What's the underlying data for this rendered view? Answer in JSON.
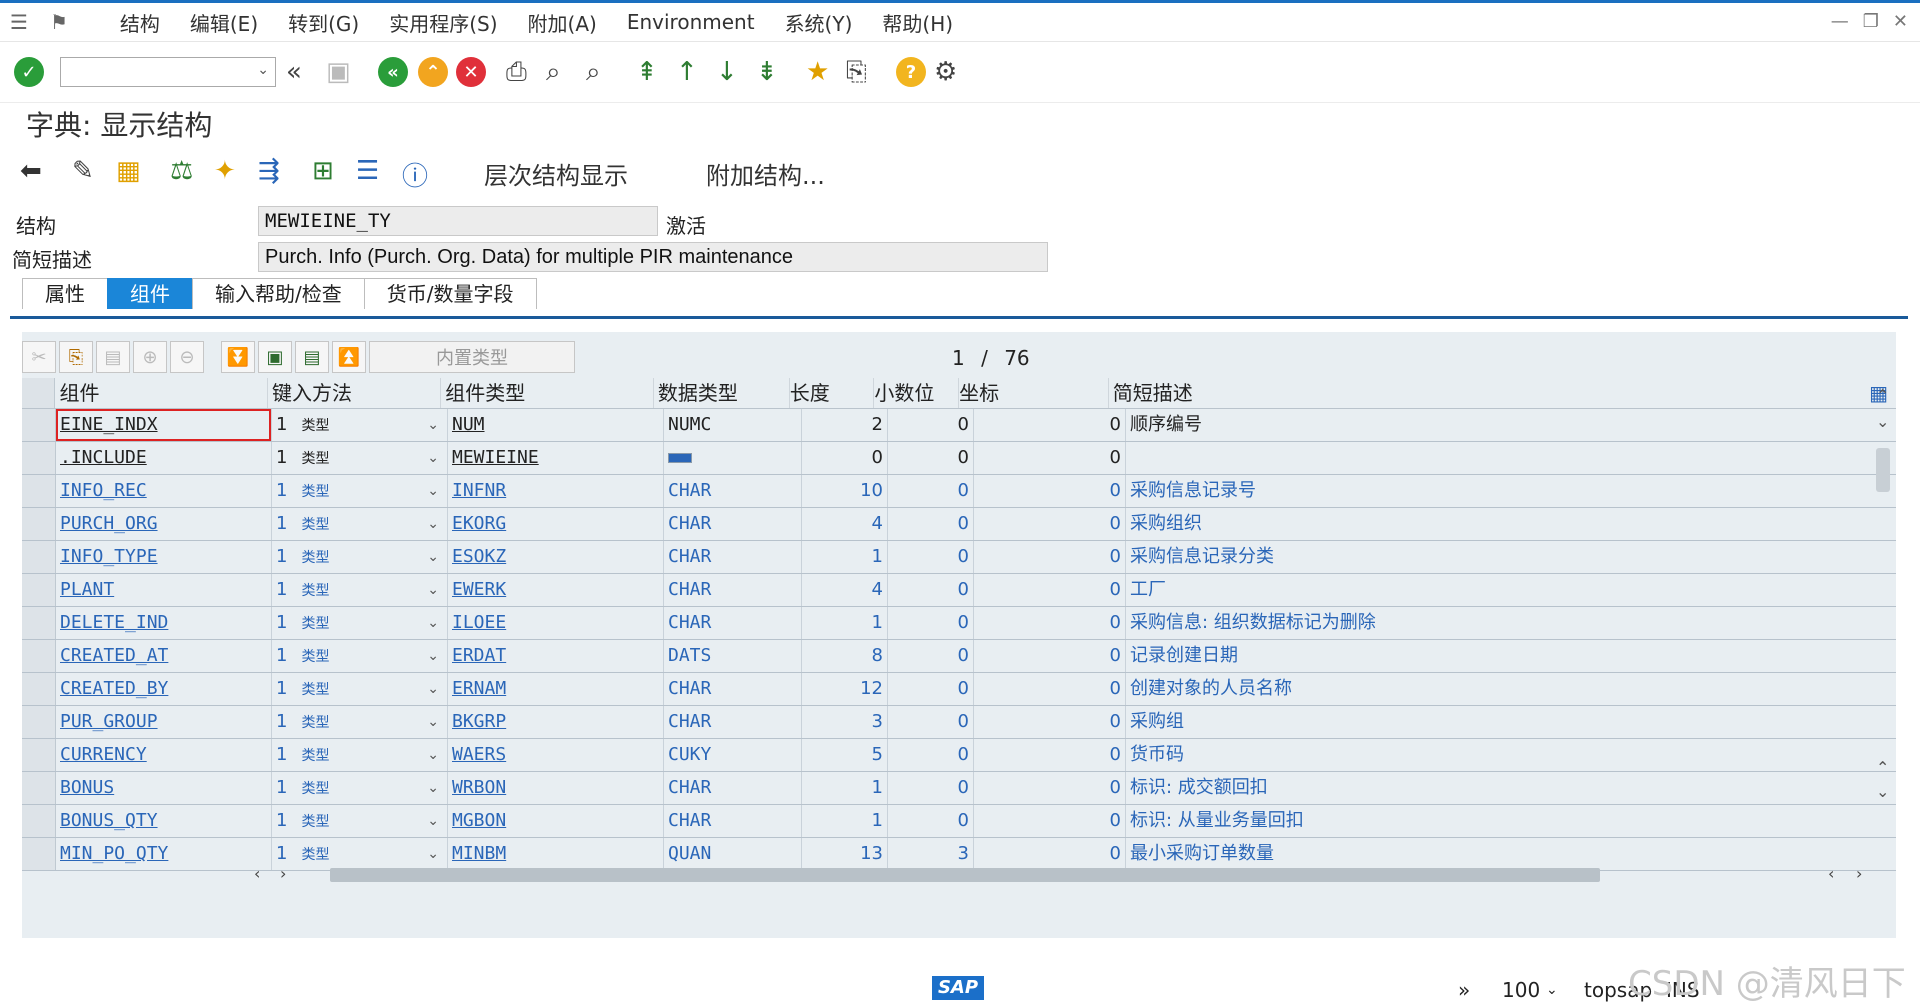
{
  "menubar": {
    "items": [
      "结构",
      "编辑(E)",
      "转到(G)",
      "实用程序(S)",
      "附加(A)",
      "Environment",
      "系统(Y)",
      "帮助(H)"
    ]
  },
  "title": "字典: 显示结构",
  "app_toolbar": {
    "hierarchy_label": "层次结构显示",
    "append_label": "附加结构..."
  },
  "header": {
    "structure_label": "结构",
    "structure_value": "MEWIEINE_TY",
    "status": "激活",
    "desc_label": "简短描述",
    "desc_value": "Purch. Info (Purch. Org. Data) for multiple PIR maintenance"
  },
  "tabs": [
    "属性",
    "组件",
    "输入帮助/检查",
    "货币/数量字段"
  ],
  "table_toolbar": {
    "builtin_type": "内置类型",
    "page_current": "1",
    "page_sep": "/",
    "page_total": "76"
  },
  "columns": [
    "组件",
    "键入方法",
    "组件类型",
    "数据类型",
    "长度",
    "小数位",
    "坐标",
    "简短描述"
  ],
  "rows": [
    {
      "component": "EINE_INDX",
      "method": "1",
      "method_text": "类型",
      "type": "NUM",
      "dtype": "NUMC",
      "length": "2",
      "decimals": "0",
      "coord": "0",
      "desc": "顺序编号"
    },
    {
      "component": ".INCLUDE",
      "method": "1",
      "method_text": "类型",
      "type": "MEWIEINE",
      "dtype": "",
      "length": "0",
      "decimals": "0",
      "coord": "0",
      "desc": ""
    },
    {
      "component": "INFO_REC",
      "method": "1",
      "method_text": "类型",
      "type": "INFNR",
      "dtype": "CHAR",
      "length": "10",
      "decimals": "0",
      "coord": "0",
      "desc": "采购信息记录号"
    },
    {
      "component": "PURCH_ORG",
      "method": "1",
      "method_text": "类型",
      "type": "EKORG",
      "dtype": "CHAR",
      "length": "4",
      "decimals": "0",
      "coord": "0",
      "desc": "采购组织"
    },
    {
      "component": "INFO_TYPE",
      "method": "1",
      "method_text": "类型",
      "type": "ESOKZ",
      "dtype": "CHAR",
      "length": "1",
      "decimals": "0",
      "coord": "0",
      "desc": "采购信息记录分类"
    },
    {
      "component": "PLANT",
      "method": "1",
      "method_text": "类型",
      "type": "EWERK",
      "dtype": "CHAR",
      "length": "4",
      "decimals": "0",
      "coord": "0",
      "desc": "工厂"
    },
    {
      "component": "DELETE_IND",
      "method": "1",
      "method_text": "类型",
      "type": "ILOEE",
      "dtype": "CHAR",
      "length": "1",
      "decimals": "0",
      "coord": "0",
      "desc": "采购信息: 组织数据标记为删除"
    },
    {
      "component": "CREATED_AT",
      "method": "1",
      "method_text": "类型",
      "type": "ERDAT",
      "dtype": "DATS",
      "length": "8",
      "decimals": "0",
      "coord": "0",
      "desc": "记录创建日期"
    },
    {
      "component": "CREATED_BY",
      "method": "1",
      "method_text": "类型",
      "type": "ERNAM",
      "dtype": "CHAR",
      "length": "12",
      "decimals": "0",
      "coord": "0",
      "desc": "创建对象的人员名称"
    },
    {
      "component": "PUR_GROUP",
      "method": "1",
      "method_text": "类型",
      "type": "BKGRP",
      "dtype": "CHAR",
      "length": "3",
      "decimals": "0",
      "coord": "0",
      "desc": "采购组"
    },
    {
      "component": "CURRENCY",
      "method": "1",
      "method_text": "类型",
      "type": "WAERS",
      "dtype": "CUKY",
      "length": "5",
      "decimals": "0",
      "coord": "0",
      "desc": "货币码"
    },
    {
      "component": "BONUS",
      "method": "1",
      "method_text": "类型",
      "type": "WRBON",
      "dtype": "CHAR",
      "length": "1",
      "decimals": "0",
      "coord": "0",
      "desc": "标识: 成交额回扣"
    },
    {
      "component": "BONUS_QTY",
      "method": "1",
      "method_text": "类型",
      "type": "MGBON",
      "dtype": "CHAR",
      "length": "1",
      "decimals": "0",
      "coord": "0",
      "desc": "标识: 从量业务量回扣"
    },
    {
      "component": "MIN_PO_QTY",
      "method": "1",
      "method_text": "类型",
      "type": "MINBM",
      "dtype": "QUAN",
      "length": "13",
      "decimals": "3",
      "coord": "0",
      "desc": "最小采购订单数量"
    }
  ],
  "statusbar": {
    "sap": "SAP",
    "zoom": "100",
    "system": "topsap",
    "mode": "INS"
  },
  "watermark": "CSDN @清风日下",
  "colors": {
    "accent": "#1b86d8",
    "link": "#2a66b8",
    "panel": "#e8eef2"
  }
}
